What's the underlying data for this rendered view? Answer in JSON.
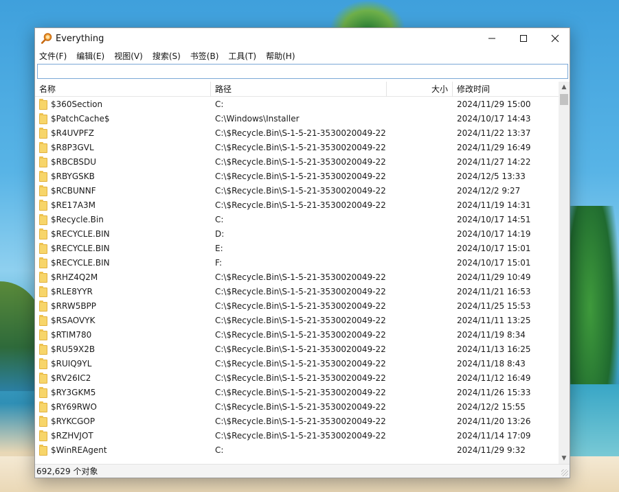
{
  "window": {
    "title": "Everything",
    "icon": "magnifier-icon"
  },
  "menubar": {
    "items": [
      "文件(F)",
      "编辑(E)",
      "视图(V)",
      "搜索(S)",
      "书签(B)",
      "工具(T)",
      "帮助(H)"
    ]
  },
  "search": {
    "value": ""
  },
  "columns": {
    "name": "名称",
    "path": "路径",
    "size": "大小",
    "date": "修改时间"
  },
  "rows": [
    {
      "name": "$360Section",
      "path": "C:",
      "size": "",
      "date": "2024/11/29 15:00"
    },
    {
      "name": "$PatchCache$",
      "path": "C:\\Windows\\Installer",
      "size": "",
      "date": "2024/10/17 14:43"
    },
    {
      "name": "$R4UVPFZ",
      "path": "C:\\$Recycle.Bin\\S-1-5-21-3530020049-22...",
      "size": "",
      "date": "2024/11/22 13:37"
    },
    {
      "name": "$R8P3GVL",
      "path": "C:\\$Recycle.Bin\\S-1-5-21-3530020049-22...",
      "size": "",
      "date": "2024/11/29 16:49"
    },
    {
      "name": "$RBCBSDU",
      "path": "C:\\$Recycle.Bin\\S-1-5-21-3530020049-22...",
      "size": "",
      "date": "2024/11/27 14:22"
    },
    {
      "name": "$RBYGSKB",
      "path": "C:\\$Recycle.Bin\\S-1-5-21-3530020049-22...",
      "size": "",
      "date": "2024/12/5 13:33"
    },
    {
      "name": "$RCBUNNF",
      "path": "C:\\$Recycle.Bin\\S-1-5-21-3530020049-22...",
      "size": "",
      "date": "2024/12/2 9:27"
    },
    {
      "name": "$RE17A3M",
      "path": "C:\\$Recycle.Bin\\S-1-5-21-3530020049-22...",
      "size": "",
      "date": "2024/11/19 14:31"
    },
    {
      "name": "$Recycle.Bin",
      "path": "C:",
      "size": "",
      "date": "2024/10/17 14:51"
    },
    {
      "name": "$RECYCLE.BIN",
      "path": "D:",
      "size": "",
      "date": "2024/10/17 14:19"
    },
    {
      "name": "$RECYCLE.BIN",
      "path": "E:",
      "size": "",
      "date": "2024/10/17 15:01"
    },
    {
      "name": "$RECYCLE.BIN",
      "path": "F:",
      "size": "",
      "date": "2024/10/17 15:01"
    },
    {
      "name": "$RHZ4Q2M",
      "path": "C:\\$Recycle.Bin\\S-1-5-21-3530020049-22...",
      "size": "",
      "date": "2024/11/29 10:49"
    },
    {
      "name": "$RLE8YYR",
      "path": "C:\\$Recycle.Bin\\S-1-5-21-3530020049-22...",
      "size": "",
      "date": "2024/11/21 16:53"
    },
    {
      "name": "$RRW5BPP",
      "path": "C:\\$Recycle.Bin\\S-1-5-21-3530020049-22...",
      "size": "",
      "date": "2024/11/25 15:53"
    },
    {
      "name": "$RSAOVYK",
      "path": "C:\\$Recycle.Bin\\S-1-5-21-3530020049-22...",
      "size": "",
      "date": "2024/11/11 13:25"
    },
    {
      "name": "$RTIM780",
      "path": "C:\\$Recycle.Bin\\S-1-5-21-3530020049-22...",
      "size": "",
      "date": "2024/11/19 8:34"
    },
    {
      "name": "$RU59X2B",
      "path": "C:\\$Recycle.Bin\\S-1-5-21-3530020049-22...",
      "size": "",
      "date": "2024/11/13 16:25"
    },
    {
      "name": "$RUIQ9YL",
      "path": "C:\\$Recycle.Bin\\S-1-5-21-3530020049-22...",
      "size": "",
      "date": "2024/11/18 8:43"
    },
    {
      "name": "$RV26IC2",
      "path": "C:\\$Recycle.Bin\\S-1-5-21-3530020049-22...",
      "size": "",
      "date": "2024/11/12 16:49"
    },
    {
      "name": "$RY3GKM5",
      "path": "C:\\$Recycle.Bin\\S-1-5-21-3530020049-22...",
      "size": "",
      "date": "2024/11/26 15:33"
    },
    {
      "name": "$RY69RWO",
      "path": "C:\\$Recycle.Bin\\S-1-5-21-3530020049-22...",
      "size": "",
      "date": "2024/12/2 15:55"
    },
    {
      "name": "$RYKCGOP",
      "path": "C:\\$Recycle.Bin\\S-1-5-21-3530020049-22...",
      "size": "",
      "date": "2024/11/20 13:26"
    },
    {
      "name": "$RZHVJOT",
      "path": "C:\\$Recycle.Bin\\S-1-5-21-3530020049-22...",
      "size": "",
      "date": "2024/11/14 17:09"
    },
    {
      "name": "$WinREAgent",
      "path": "C:",
      "size": "",
      "date": "2024/11/29 9:32"
    }
  ],
  "status": {
    "count": "692,629 个对象"
  }
}
